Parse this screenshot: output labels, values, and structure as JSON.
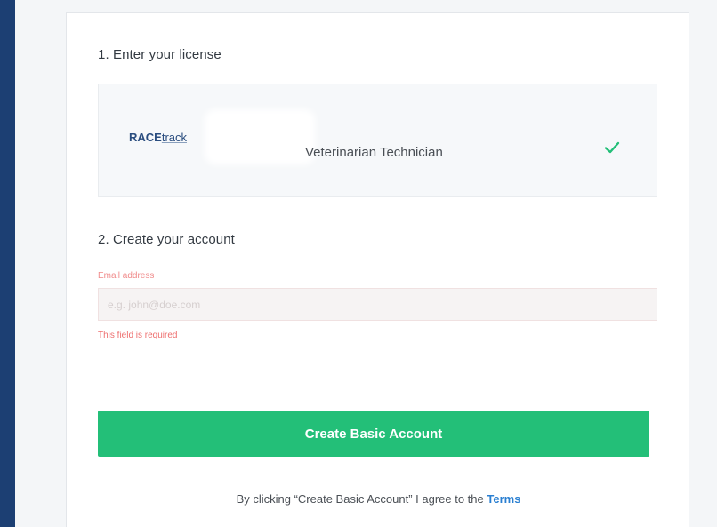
{
  "steps": {
    "license_title": "1. Enter your license",
    "account_title": "2. Create your account"
  },
  "license": {
    "logo_main": "RACE",
    "logo_sub": "track",
    "type": "Veterinarian Technician",
    "verified_icon": "check-icon",
    "verified_color": "#23bf78"
  },
  "account": {
    "email_label": "Email address",
    "email_placeholder": "e.g. john@doe.com",
    "email_value": "",
    "error_message": "This field is required"
  },
  "actions": {
    "create_label": "Create Basic Account",
    "create_color": "#23bf78"
  },
  "terms": {
    "prefix": "By clicking “Create Basic Account” I agree to the ",
    "link_label": "Terms"
  }
}
